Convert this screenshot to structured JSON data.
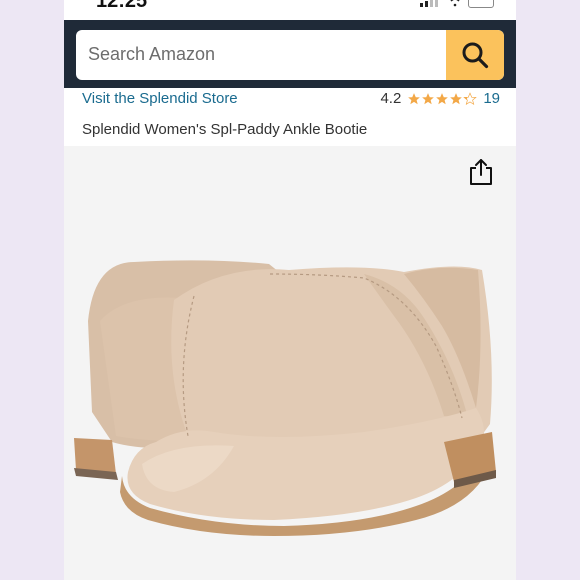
{
  "status_bar": {
    "time": "12:25"
  },
  "search": {
    "placeholder": "Search Amazon"
  },
  "store": {
    "link_label": "Visit the Splendid Store"
  },
  "rating": {
    "value": "4.2",
    "stars": 4.2,
    "count": "19"
  },
  "product": {
    "title": "Splendid Women's Spl-Paddy Ankle Bootie"
  },
  "colors": {
    "header_bg": "#1f2a38",
    "search_button": "#fbc25c",
    "link": "#1a6b8f",
    "star": "#f3a847"
  },
  "icons": {
    "search": "search-icon",
    "share": "share-icon",
    "star": "star-icon"
  }
}
